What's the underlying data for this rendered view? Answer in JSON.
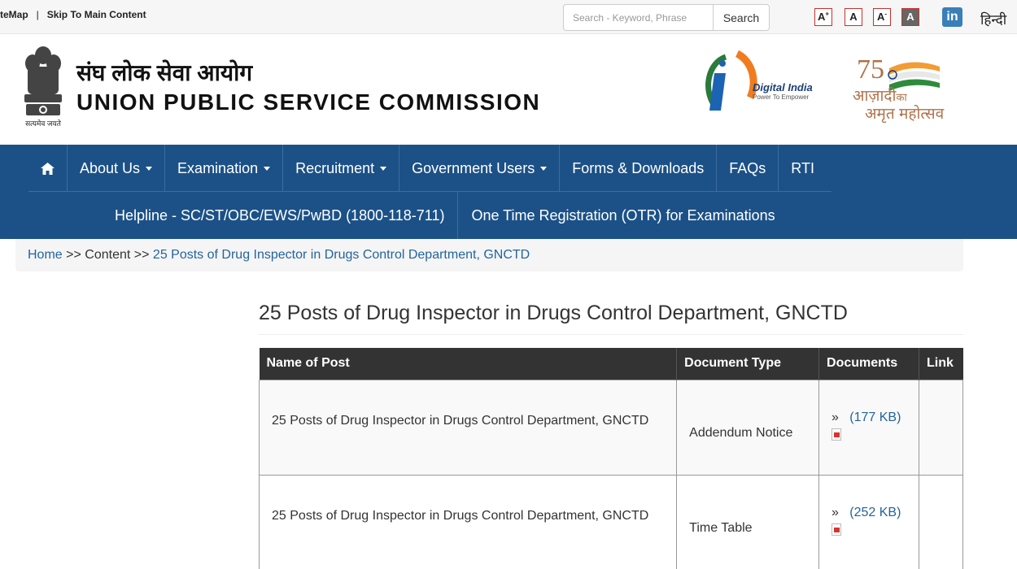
{
  "topbar": {
    "sitemap": "teMap",
    "separator": "|",
    "skip": "Skip To Main Content",
    "search_placeholder": "Search - Keyword, Phrase",
    "search_label": "Search",
    "font_increase": "A",
    "font_normal": "A",
    "font_decrease": "A",
    "font_contrast": "A",
    "font_plus": "+",
    "font_minus": "-",
    "linkedin_label": "in",
    "hindi_label": "हिन्दी"
  },
  "header": {
    "title_hindi": "संघ लोक सेवा आयोग",
    "title_english": "UNION PUBLIC SERVICE COMMISSION",
    "emblem_caption": "सत्यमेव जयते",
    "digital_india": "Digital India",
    "digital_india_tagline": "Power To Empower",
    "azadi_line1": "आज़ादी",
    "azadi_ka": "का",
    "azadi_line2": "अमृत महोत्सव",
    "azadi_number": "75"
  },
  "nav": {
    "row1": [
      {
        "label": "About Us",
        "dropdown": true
      },
      {
        "label": "Examination",
        "dropdown": true
      },
      {
        "label": "Recruitment",
        "dropdown": true
      },
      {
        "label": "Government Users",
        "dropdown": true
      },
      {
        "label": "Forms & Downloads",
        "dropdown": false
      },
      {
        "label": "FAQs",
        "dropdown": false
      },
      {
        "label": "RTI",
        "dropdown": false
      }
    ],
    "row2": [
      {
        "label": "Helpline - SC/ST/OBC/EWS/PwBD (1800-118-711)"
      },
      {
        "label": "One Time Registration (OTR) for Examinations"
      }
    ]
  },
  "breadcrumb": {
    "home": "Home",
    "sep": ">>",
    "content": "Content",
    "current": "25 Posts of Drug Inspector in Drugs Control Department, GNCTD"
  },
  "page": {
    "title": "25 Posts of Drug Inspector in Drugs Control Department, GNCTD"
  },
  "table": {
    "headers": [
      "Name of Post",
      "Document Type",
      "Documents",
      "Link"
    ],
    "rows": [
      {
        "name": "25 Posts of Drug Inspector in Drugs Control Department, GNCTD",
        "type": "Addendum Notice",
        "doc_marker": "»",
        "doc_size": "(177 KB)",
        "link": ""
      },
      {
        "name": "25 Posts of Drug Inspector in Drugs Control Department, GNCTD",
        "type": "Time Table",
        "doc_marker": "»",
        "doc_size": "(252 KB)",
        "link": ""
      }
    ]
  },
  "colors": {
    "nav_bg": "#1c5187",
    "link": "#23649e",
    "table_header": "#333333"
  }
}
